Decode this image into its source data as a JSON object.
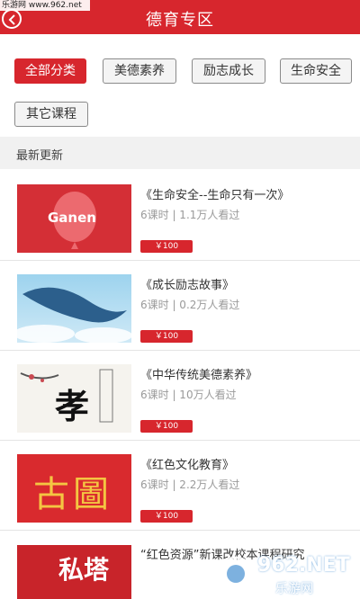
{
  "watermark_top": "乐游网 www.962.net",
  "header": {
    "title": "德育专区"
  },
  "filters": [
    {
      "label": "全部分类",
      "active": true
    },
    {
      "label": "美德素养",
      "active": false
    },
    {
      "label": "励志成长",
      "active": false
    },
    {
      "label": "生命安全",
      "active": false
    },
    {
      "label": "其它课程",
      "active": false
    }
  ],
  "section": {
    "title": "最新更新"
  },
  "courses": [
    {
      "title": "《生命安全--生命只有一次》",
      "meta": "6课时 | 1.1万人看过",
      "price": "￥100",
      "thumb_text": "Ganen"
    },
    {
      "title": "《成长励志故事》",
      "meta": "6课时 | 0.2万人看过",
      "price": "￥100"
    },
    {
      "title": "《中华传统美德素养》",
      "meta": "6课时 | 10万人看过",
      "price": "￥100",
      "thumb_text": "孝"
    },
    {
      "title": "《红色文化教育》",
      "meta": "6课时 | 2.2万人看过",
      "price": "￥100",
      "thumb_text": "古圖"
    },
    {
      "title": "“红色资源”新课改校本课程研究",
      "meta": "",
      "price": "",
      "thumb_text": "私塔"
    }
  ],
  "watermark_bottom": {
    "brand": "962.NET",
    "sub": "乐游网"
  },
  "colors": {
    "accent": "#d7262d",
    "chip_bg": "#f4f4f4",
    "section_bg": "#f1f1f1"
  }
}
